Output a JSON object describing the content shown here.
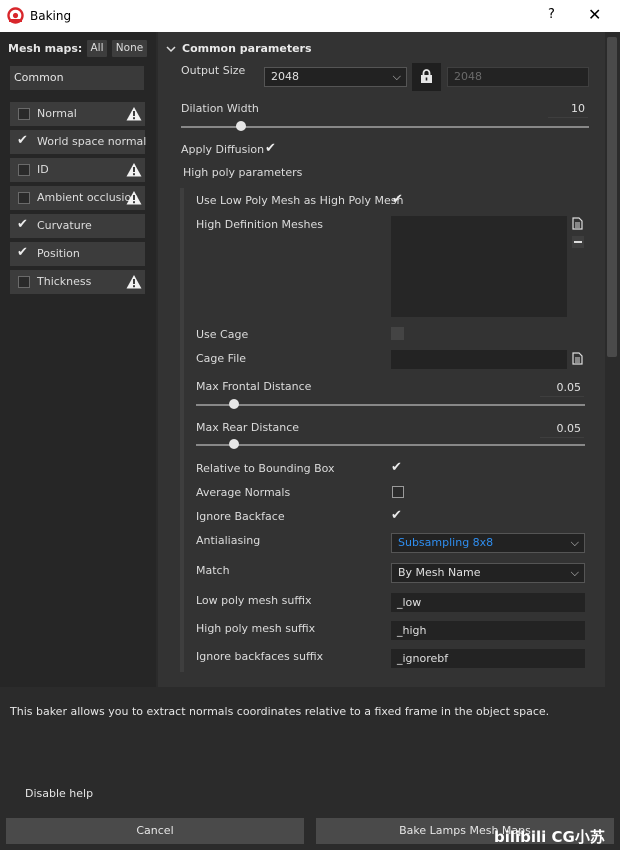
{
  "window": {
    "title": "Baking",
    "help_glyph": "?",
    "close_glyph": "✕",
    "logo_icon": "substance-painter-logo"
  },
  "left": {
    "mesh_maps_label": "Mesh maps:",
    "all_label": "All",
    "none_label": "None",
    "common_label": "Common",
    "items": [
      {
        "label": "Normal",
        "checked": false,
        "warning": true
      },
      {
        "label": "World space normal",
        "checked": true,
        "warning": false
      },
      {
        "label": "ID",
        "checked": false,
        "warning": true
      },
      {
        "label": "Ambient occlusion",
        "checked": false,
        "warning": true
      },
      {
        "label": "Curvature",
        "checked": true,
        "warning": false
      },
      {
        "label": "Position",
        "checked": true,
        "warning": false
      },
      {
        "label": "Thickness",
        "checked": false,
        "warning": true
      }
    ]
  },
  "params": {
    "section_title": "Common parameters",
    "output_size_label": "Output Size",
    "output_size_value": "2048",
    "output_size_locked_value": "2048",
    "dilation_label": "Dilation Width",
    "dilation_value": "10",
    "dilation_fraction": 0.1,
    "apply_diffusion_label": "Apply Diffusion",
    "high_poly_title": "High poly parameters",
    "use_low_poly_label": "Use Low Poly Mesh as High Poly Mesh",
    "hd_meshes_label": "High Definition Meshes",
    "use_cage_label": "Use Cage",
    "cage_file_label": "Cage File",
    "max_frontal_label": "Max Frontal Distance",
    "max_frontal_value": "0.05",
    "max_frontal_fraction": 0.05,
    "max_rear_label": "Max Rear Distance",
    "max_rear_value": "0.05",
    "max_rear_fraction": 0.05,
    "relative_bbox_label": "Relative to Bounding Box",
    "average_normals_label": "Average Normals",
    "ignore_backface_label": "Ignore Backface",
    "antialiasing_label": "Antialiasing",
    "antialiasing_value": "Subsampling 8x8",
    "match_label": "Match",
    "match_value": "By Mesh Name",
    "low_suffix_label": "Low poly mesh suffix",
    "low_suffix_value": "_low",
    "high_suffix_label": "High poly mesh suffix",
    "high_suffix_value": "_high",
    "ignore_bf_suffix_label": "Ignore backfaces suffix",
    "ignore_bf_suffix_value": "_ignorebf",
    "accent_color": "#2f8ef0"
  },
  "footer": {
    "help_text": "This baker allows you to extract normals coordinates relative to a fixed frame in the object space.",
    "disable_help": "Disable help",
    "cancel": "Cancel",
    "bake": "Bake Lamps Mesh Maps",
    "watermark": "bilibili CG小苏"
  }
}
